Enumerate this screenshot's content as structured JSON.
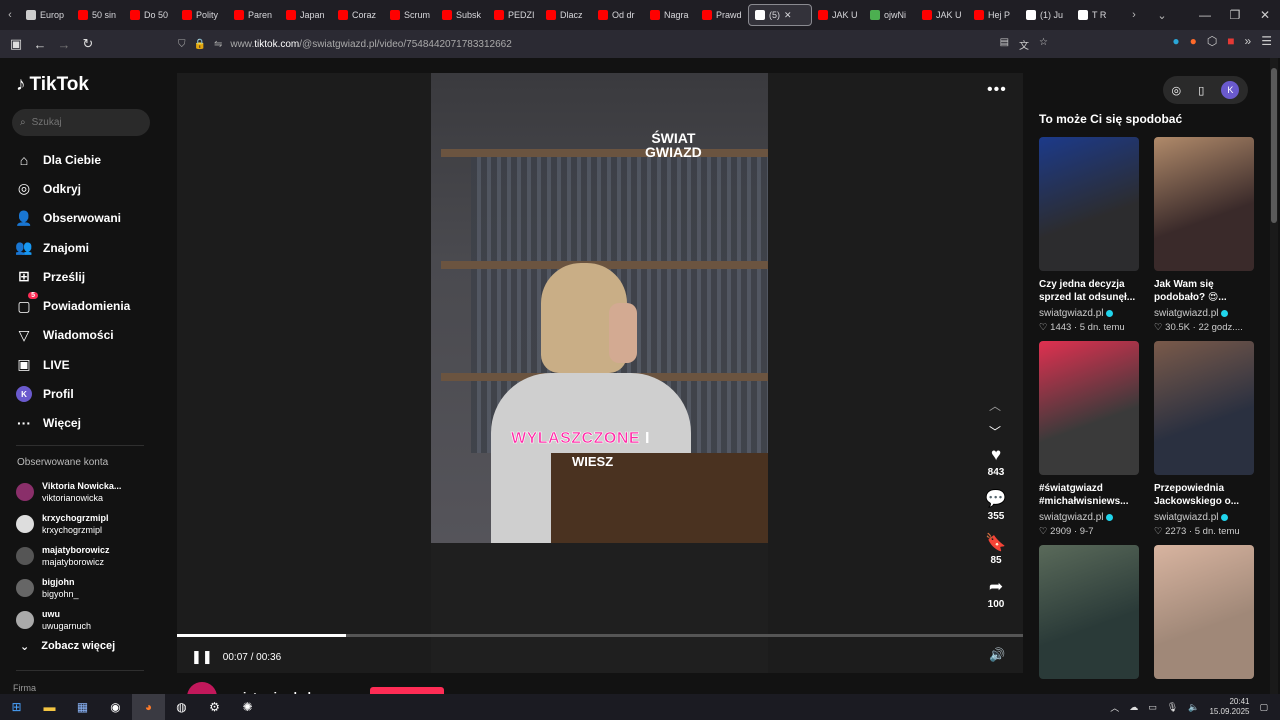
{
  "browser": {
    "tabs": [
      {
        "label": "Europ",
        "color": "#cccccc"
      },
      {
        "label": "50 sin",
        "color": "#ff0000"
      },
      {
        "label": "Do 50",
        "color": "#ff0000"
      },
      {
        "label": "Polity",
        "color": "#ff0000"
      },
      {
        "label": "Paren",
        "color": "#ff0000"
      },
      {
        "label": "Japan",
        "color": "#ff0000"
      },
      {
        "label": "Coraz",
        "color": "#ff0000"
      },
      {
        "label": "Scrum",
        "color": "#ff0000"
      },
      {
        "label": "Subsk",
        "color": "#ff0000"
      },
      {
        "label": "PEDZI",
        "color": "#ff0000"
      },
      {
        "label": "Dlacz",
        "color": "#ff0000"
      },
      {
        "label": "Od dr",
        "color": "#ff0000"
      },
      {
        "label": "Nagra",
        "color": "#ff0000"
      },
      {
        "label": "Prawd",
        "color": "#ff0000"
      },
      {
        "label": "(5)",
        "color": "#ffffff",
        "active": true
      },
      {
        "label": "JAK U",
        "color": "#ff0000"
      },
      {
        "label": "ojwNi",
        "color": "#4caf50"
      },
      {
        "label": "JAK U",
        "color": "#ff0000"
      },
      {
        "label": "Hej P",
        "color": "#ff0000"
      },
      {
        "label": "(1) Ju",
        "color": "#ffffff"
      },
      {
        "label": "T R",
        "color": "#ffffff"
      }
    ],
    "url_prefix": "www.",
    "url_host": "tiktok.com",
    "url_path": "/@swiatgwiazd.pl/video/7548442071783312662"
  },
  "sidebar": {
    "logo": "TikTok",
    "search_placeholder": "Szukaj",
    "menu": [
      {
        "label": "Dla Ciebie",
        "icon": "home-icon",
        "glyph": "⌂"
      },
      {
        "label": "Odkryj",
        "icon": "compass-icon",
        "glyph": "◎"
      },
      {
        "label": "Obserwowani",
        "icon": "following-icon",
        "glyph": "👤"
      },
      {
        "label": "Znajomi",
        "icon": "friends-icon",
        "glyph": "👥"
      },
      {
        "label": "Prześlij",
        "icon": "upload-icon",
        "glyph": "⊞"
      },
      {
        "label": "Powiadomienia",
        "icon": "notifications-icon",
        "glyph": "▢",
        "badge": "5"
      },
      {
        "label": "Wiadomości",
        "icon": "messages-icon",
        "glyph": "▽"
      },
      {
        "label": "LIVE",
        "icon": "live-icon",
        "glyph": "▣"
      },
      {
        "label": "Profil",
        "icon": "profile-avatar",
        "glyph": "K"
      },
      {
        "label": "Więcej",
        "icon": "more-icon",
        "glyph": "···"
      }
    ],
    "followed_title": "Obserwowane konta",
    "accounts": [
      {
        "name": "Viktoria Nowicka...",
        "handle": "viktorianowicka",
        "color": "#8a2f6a"
      },
      {
        "name": "krxychogrzmipl",
        "handle": "krxychogrzmipl",
        "color": "#dddddd"
      },
      {
        "name": "majatyborowicz",
        "handle": "majatyborowicz",
        "color": "#555555"
      },
      {
        "name": "bigjohn",
        "handle": "bigyohn_",
        "color": "#666666"
      },
      {
        "name": "uwu",
        "handle": "uwugarnuch",
        "color": "#aaaaaa"
      }
    ],
    "see_more": "Zobacz więcej",
    "firma": "Firma"
  },
  "player": {
    "watermark_line1": "ŚWIAT",
    "watermark_line2": "GWIAZD",
    "caption_pink": "WYLASZCZONE",
    "caption_white": "I",
    "caption_line2": "WIESZ",
    "likes": "843",
    "comments": "355",
    "saves": "85",
    "shares": "100",
    "time": "00:07 / 00:36",
    "progress": 0.2
  },
  "author": {
    "name": "swiatgwiazd.pl"
  },
  "recommendations": {
    "title": "To może Ci się spodobać",
    "cards": [
      {
        "title": "Czy jedna decyzja sprzed lat odsunęł...",
        "author": "swiatgwiazd.pl",
        "likes": "1443",
        "age": "5 dn. temu",
        "thumb": "#2c2c2e",
        "accent": "#1c3a8a"
      },
      {
        "title": "Jak Wam się podobało? 😍...",
        "author": "swiatgwiazd.pl",
        "likes": "30.5K",
        "age": "22 godz....",
        "thumb": "#3a2a2a",
        "accent": "#b08a6a"
      },
      {
        "title": "#światgwiazd #michałwisniews...",
        "author": "swiatgwiazd.pl",
        "likes": "2909",
        "age": "9-7",
        "thumb": "#3a3a3a",
        "accent": "#e03050"
      },
      {
        "title": "Przepowiednia Jackowskiego o...",
        "author": "swiatgwiazd.pl",
        "likes": "2273",
        "age": "5 dn. temu",
        "thumb": "#2a3040",
        "accent": "#7a5a4a"
      },
      {
        "title": "",
        "author": "",
        "likes": "",
        "age": "",
        "thumb": "#2a3a38",
        "accent": "#5a6a5a"
      },
      {
        "title": "",
        "author": "",
        "likes": "",
        "age": "",
        "thumb": "#a08878",
        "accent": "#d8b4a0"
      }
    ]
  },
  "taskbar": {
    "time": "20:41",
    "date": "15.09.2025"
  }
}
